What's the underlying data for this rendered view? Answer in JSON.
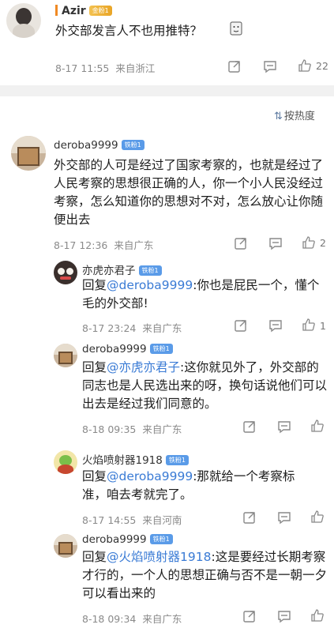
{
  "top_post": {
    "username": "Azir",
    "badge": "金粉1",
    "text": "外交部发言人不也用推特？",
    "time": "8-17 11:55",
    "location": "来自浙江",
    "likes": "22"
  },
  "sort_label": "按热度",
  "comment": {
    "username": "deroba9999",
    "badge": "铁粉1",
    "text": "外交部的人可是经过了国家考察的，也就是经过了人民考察的思想很正确的人，你一个小人民没经过考察，怎么知道你的思想对不对，怎么放心让你随便出去",
    "time": "8-17 12:36",
    "location": "来自广东",
    "likes": "2"
  },
  "replies": [
    {
      "username": "亦虎亦君子",
      "badge": "铁粉1",
      "reply_prefix": "回复",
      "mention": "@deroba9999",
      "text": ":你也是屁民一个，懂个毛的外交部!",
      "time": "8-17 23:24",
      "location": "来自广东",
      "likes": "1"
    },
    {
      "username": "deroba9999",
      "badge": "铁粉1",
      "reply_prefix": "回复",
      "mention": "@亦虎亦君子",
      "text": ":这你就见外了，外交部的同志也是人民选出来的呀，换句话说他们可以出去是经过我们同意的。",
      "time": "8-18 09:35",
      "location": "来自广东",
      "likes": ""
    },
    {
      "username": "火焰喷射器1918",
      "badge": "铁粉1",
      "reply_prefix": "回复",
      "mention": "@deroba9999",
      "text": ":那就给一个考察标准，咱去考就完了。",
      "time": "8-17 14:55",
      "location": "来自河南",
      "likes": ""
    },
    {
      "username": "deroba9999",
      "badge": "铁粉1",
      "reply_prefix": "回复",
      "mention": "@火焰喷射器1918",
      "text": ":这是要经过长期考察才行的，一个人的思想正确与否不是一朝一夕可以看出来的",
      "time": "8-18 09:34",
      "location": "来自广东",
      "likes": ""
    }
  ],
  "icons": [
    "share-icon",
    "comment-icon",
    "like-icon",
    "sort-icon"
  ]
}
